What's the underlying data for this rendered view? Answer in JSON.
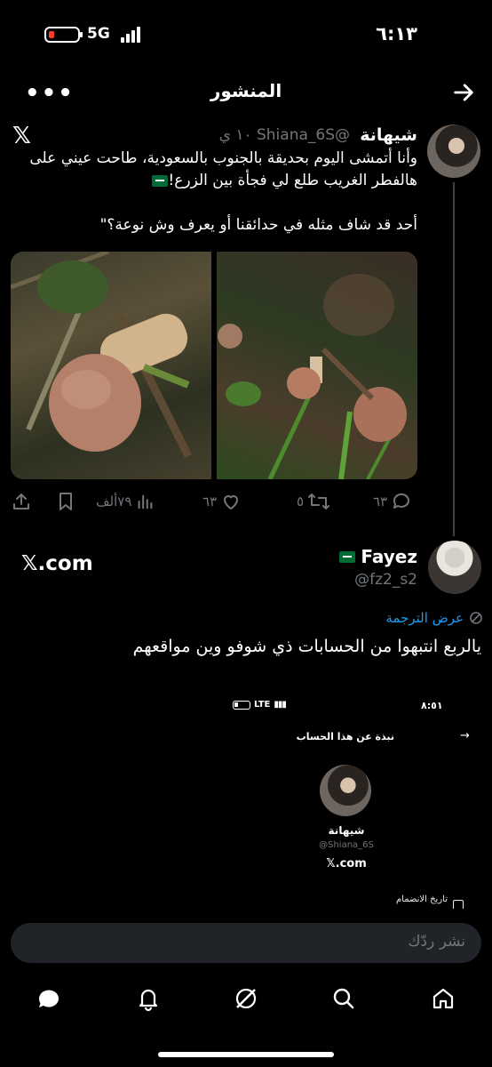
{
  "status_bar": {
    "time": "٦:١٣",
    "network": "5G"
  },
  "header": {
    "title": "المنشور"
  },
  "quoted_post": {
    "name": "شيهانة",
    "handle": "@Shiana_6S",
    "time": "١٠ ي",
    "text": "وأنا أتمشى اليوم بحديقة بالجنوب بالسعودية، طاحت عيني على هالفطر الغريب طلع لي فجأة بين الزرع!\n\nأحد قد شاف مثله في حدائقنا أو يعرف وش نوعة؟\"",
    "actions": {
      "replies": "٦٣",
      "reposts": "٥",
      "likes": "٦٣",
      "views": "٧٩ألف"
    }
  },
  "reply_post": {
    "name": "Fayez",
    "handle": "@fz2_s2",
    "brand": "𝕏.com",
    "translate_label": "عرض الترجمة",
    "text": "يالربع انتبهوا من الحسابات ذي شوفو وين مواقعهم"
  },
  "embedded_screenshot": {
    "time": "٨:٥١",
    "network": "LTE",
    "title": "نبذة عن هذا الحساب",
    "name": "شيهانة",
    "handle": "@Shiana_6S",
    "brand": "𝕏.com",
    "join_label": "تاريخ الانضمام"
  },
  "reply_input": {
    "placeholder": "نشر ردّك"
  },
  "bottom_nav": [
    "home-icon",
    "search-icon",
    "grok-icon",
    "notifications-icon",
    "messages-icon"
  ],
  "colors": {
    "accent": "#1d9bf0",
    "muted": "#71767b",
    "background": "#000000",
    "input_bg": "#202327"
  }
}
